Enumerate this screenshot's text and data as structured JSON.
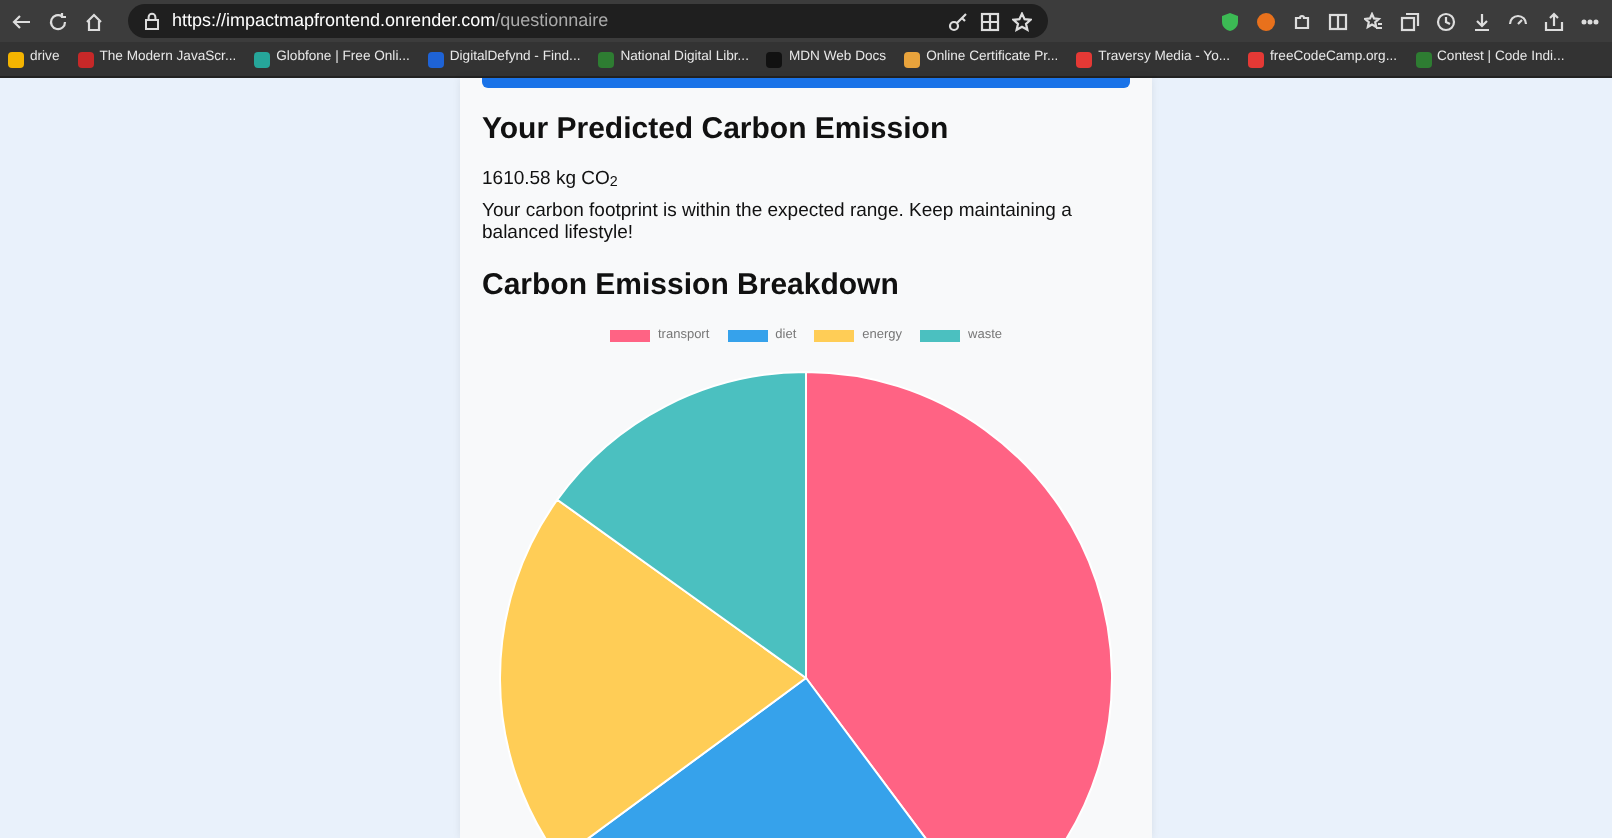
{
  "browser": {
    "url_host": "https://impactmapfrontend.onrender.com",
    "url_path": "/questionnaire",
    "bookmarks": [
      {
        "label": "drive",
        "color": "#f4b400"
      },
      {
        "label": "The Modern JavaScr...",
        "color": "#c62828"
      },
      {
        "label": "Globfone | Free Onli...",
        "color": "#26a69a"
      },
      {
        "label": "DigitalDefynd - Find...",
        "color": "#1e63d6"
      },
      {
        "label": "National Digital Libr...",
        "color": "#2e7d32"
      },
      {
        "label": "MDN Web Docs",
        "color": "#111111"
      },
      {
        "label": "Online Certificate Pr...",
        "color": "#e8a33c"
      },
      {
        "label": "Traversy Media - Yo...",
        "color": "#e53935"
      },
      {
        "label": "freeCodeCamp.org...",
        "color": "#e53935"
      },
      {
        "label": "Contest | Code Indi...",
        "color": "#2e7d32"
      }
    ]
  },
  "result": {
    "title": "Your Predicted Carbon Emission",
    "amount": "1610.58 kg CO$_{2}$",
    "message": "Your carbon footprint is within the expected range. Keep maintaining a balanced lifestyle!"
  },
  "breakdown": {
    "title": "Carbon Emission Breakdown",
    "legend": [
      {
        "label": "transport",
        "color": "#ff6384"
      },
      {
        "label": "diet",
        "color": "#36a2eb"
      },
      {
        "label": "energy",
        "color": "#ffcd56"
      },
      {
        "label": "waste",
        "color": "#4bc0c0"
      }
    ]
  }
}
